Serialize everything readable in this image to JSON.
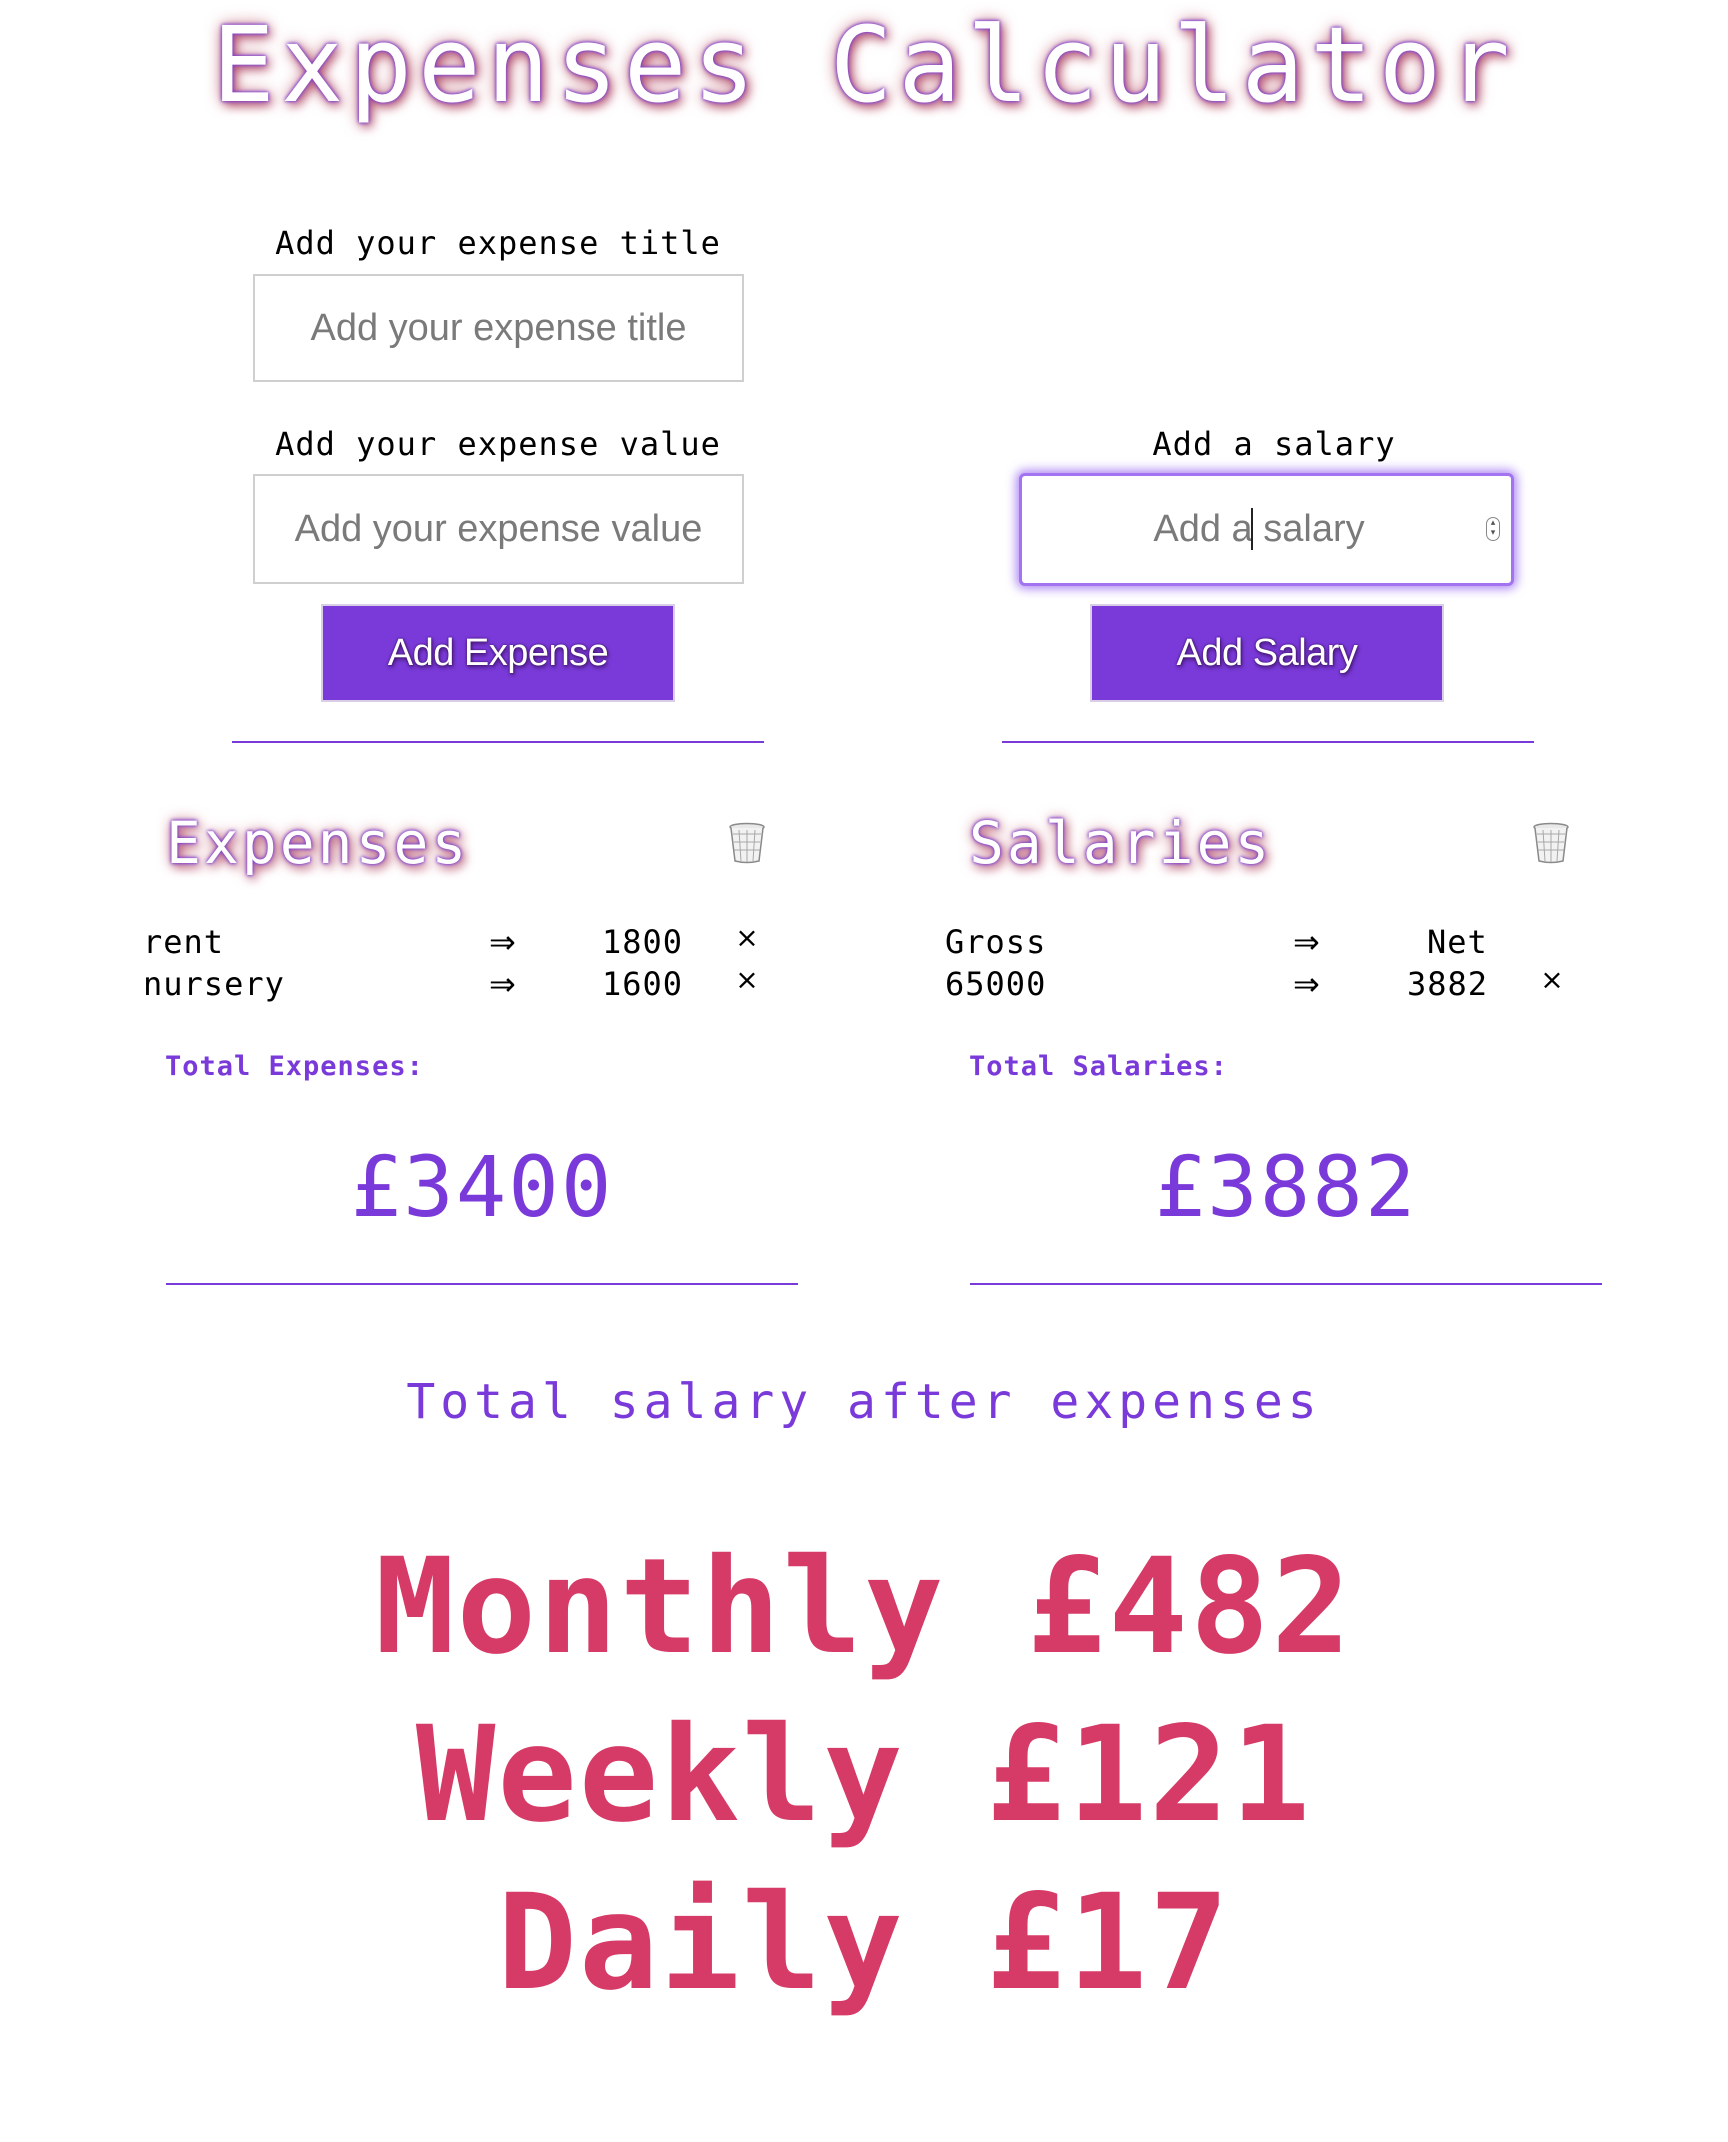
{
  "app": {
    "title": "Expenses Calculator"
  },
  "expense_form": {
    "title_label": "Add your expense title",
    "title_placeholder": "Add your expense title",
    "title_value": "",
    "value_label": "Add your expense value",
    "value_placeholder": "Add your expense value",
    "value_value": "",
    "button_label": "Add Expense"
  },
  "salary_form": {
    "label": "Add a salary",
    "placeholder": "Add a salary",
    "value": "",
    "button_label": "Add Salary"
  },
  "expenses": {
    "heading": "Expenses",
    "delete_icon": "trash-icon",
    "arrow": "⇒",
    "remove": "×",
    "items": [
      {
        "title": "rent",
        "value": "1800"
      },
      {
        "title": "nursery",
        "value": "1600"
      }
    ],
    "total_label": "Total Expenses:",
    "total_value": "£3400"
  },
  "salaries": {
    "heading": "Salaries",
    "delete_icon": "trash-icon",
    "arrow": "⇒",
    "remove": "×",
    "header": {
      "gross": "Gross",
      "net": "Net"
    },
    "items": [
      {
        "gross": "65000",
        "net": "3882"
      }
    ],
    "total_label": "Total Salaries:",
    "total_value": "£3882"
  },
  "summary": {
    "label": "Total salary after expenses",
    "monthly": "Monthly £482",
    "weekly": "Weekly £121",
    "daily": "Daily £17"
  },
  "colors": {
    "accent": "#7a3ad9",
    "summary": "#d63a66",
    "focus_ring": "#a274ef"
  }
}
